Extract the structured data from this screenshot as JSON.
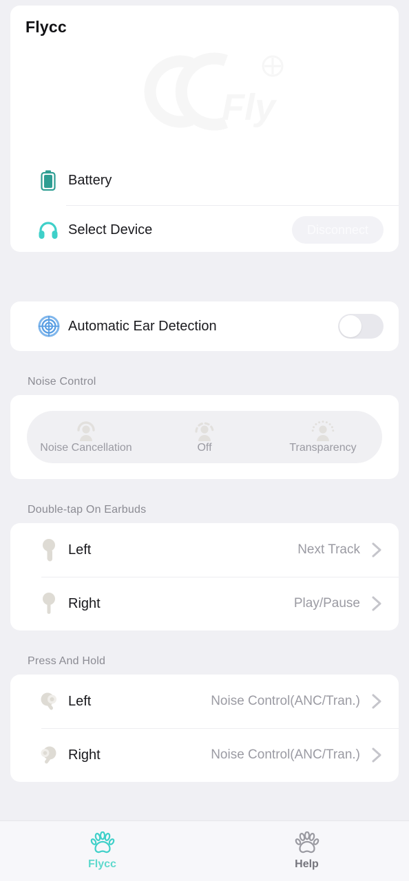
{
  "app": {
    "accent_teal": "#3fd0c9",
    "accent_blue": "#5b9fe3",
    "background": "#f0f0f4",
    "card_background": "#ffffff",
    "muted_text": "#9b9ba3"
  },
  "device_card": {
    "title": "Flycc",
    "watermark_text": "Fly",
    "watermark_name": "cc-fly-logo-watermark",
    "rows": [
      {
        "icon": "battery-icon",
        "label": "Battery"
      },
      {
        "icon": "headphone-icon",
        "label": "Select Device"
      }
    ],
    "disconnect_label": "Disconnect"
  },
  "ear_detection": {
    "icon": "radar-target-icon",
    "label": "Automatic Ear Detection",
    "toggle_state": "off"
  },
  "noise_control": {
    "section_title": "Noise Control",
    "options": [
      {
        "icon": "anc-person-icon",
        "label": "Noise Cancellation",
        "selected": false
      },
      {
        "icon": "off-person-icon",
        "label": "Off",
        "selected": false
      },
      {
        "icon": "transparency-person-icon",
        "label": "Transparency",
        "selected": false
      }
    ]
  },
  "double_tap": {
    "section_title": "Double-tap On Earbuds",
    "rows": [
      {
        "icon": "earbud-left-icon",
        "label": "Left",
        "value": "Next Track"
      },
      {
        "icon": "earbud-right-icon",
        "label": "Right",
        "value": "Play/Pause"
      }
    ]
  },
  "press_hold": {
    "section_title": "Press And Hold",
    "rows": [
      {
        "icon": "earbud-press-left-icon",
        "label": "Left",
        "value": "Noise Control(ANC/Tran.)"
      },
      {
        "icon": "earbud-press-right-icon",
        "label": "Right",
        "value": "Noise Control(ANC/Tran.)"
      }
    ]
  },
  "tabbar": {
    "tabs": [
      {
        "icon": "paw-icon",
        "label": "Flycc",
        "active": true
      },
      {
        "icon": "paw-icon",
        "label": "Help",
        "active": false
      }
    ]
  }
}
